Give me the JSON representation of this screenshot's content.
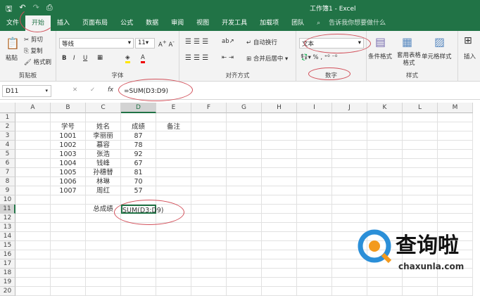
{
  "title": "工作簿1 - Excel",
  "tabs": [
    "文件",
    "开始",
    "插入",
    "页面布局",
    "公式",
    "数据",
    "审阅",
    "视图",
    "开发工具",
    "加载项",
    "团队"
  ],
  "search": "告诉我你想要做什么",
  "ribbon": {
    "clipboard": {
      "paste": "粘贴",
      "cut": "剪切",
      "copy": "复制",
      "format_painter": "格式刷",
      "label": "剪贴板"
    },
    "font": {
      "name": "等线",
      "size": "11",
      "label": "字体"
    },
    "align": {
      "wrap": "自动换行",
      "merge": "合并后居中",
      "label": "对齐方式"
    },
    "number": {
      "format": "文本",
      "label": "数字"
    },
    "styles": {
      "cond": "条件格式",
      "table": "套用表格格式",
      "cell": "单元格样式",
      "label": "样式"
    },
    "cells": {
      "insert": "插入"
    }
  },
  "namebox": "D11",
  "formula": "=SUM(D3:D9)",
  "columns": [
    "A",
    "B",
    "C",
    "D",
    "E",
    "F",
    "G",
    "H",
    "I",
    "J",
    "K",
    "L",
    "M"
  ],
  "rows": [
    "1",
    "2",
    "3",
    "4",
    "5",
    "6",
    "7",
    "8",
    "9",
    "10",
    "11",
    "12",
    "13",
    "14",
    "15",
    "16",
    "17",
    "18",
    "19",
    "20"
  ],
  "cells": {
    "B2": "学号",
    "C2": "姓名",
    "D2": "成绩",
    "E2": "备注",
    "B3": "1001",
    "C3": "李丽丽",
    "D3": "87",
    "B4": "1002",
    "C4": "慕容",
    "D4": "78",
    "B5": "1003",
    "C5": "张浩",
    "D5": "92",
    "B6": "1004",
    "C6": "钱峰",
    "D6": "67",
    "B7": "1005",
    "C7": "孙穗替",
    "D7": "81",
    "B8": "1006",
    "C8": "林琳",
    "D8": "70",
    "B9": "1007",
    "C9": "周红",
    "D9": "57",
    "C11": "总成绩",
    "D11": "SUM(D3:D9)"
  },
  "logo": {
    "name": "查询啦",
    "url": "chaxunla.com"
  }
}
